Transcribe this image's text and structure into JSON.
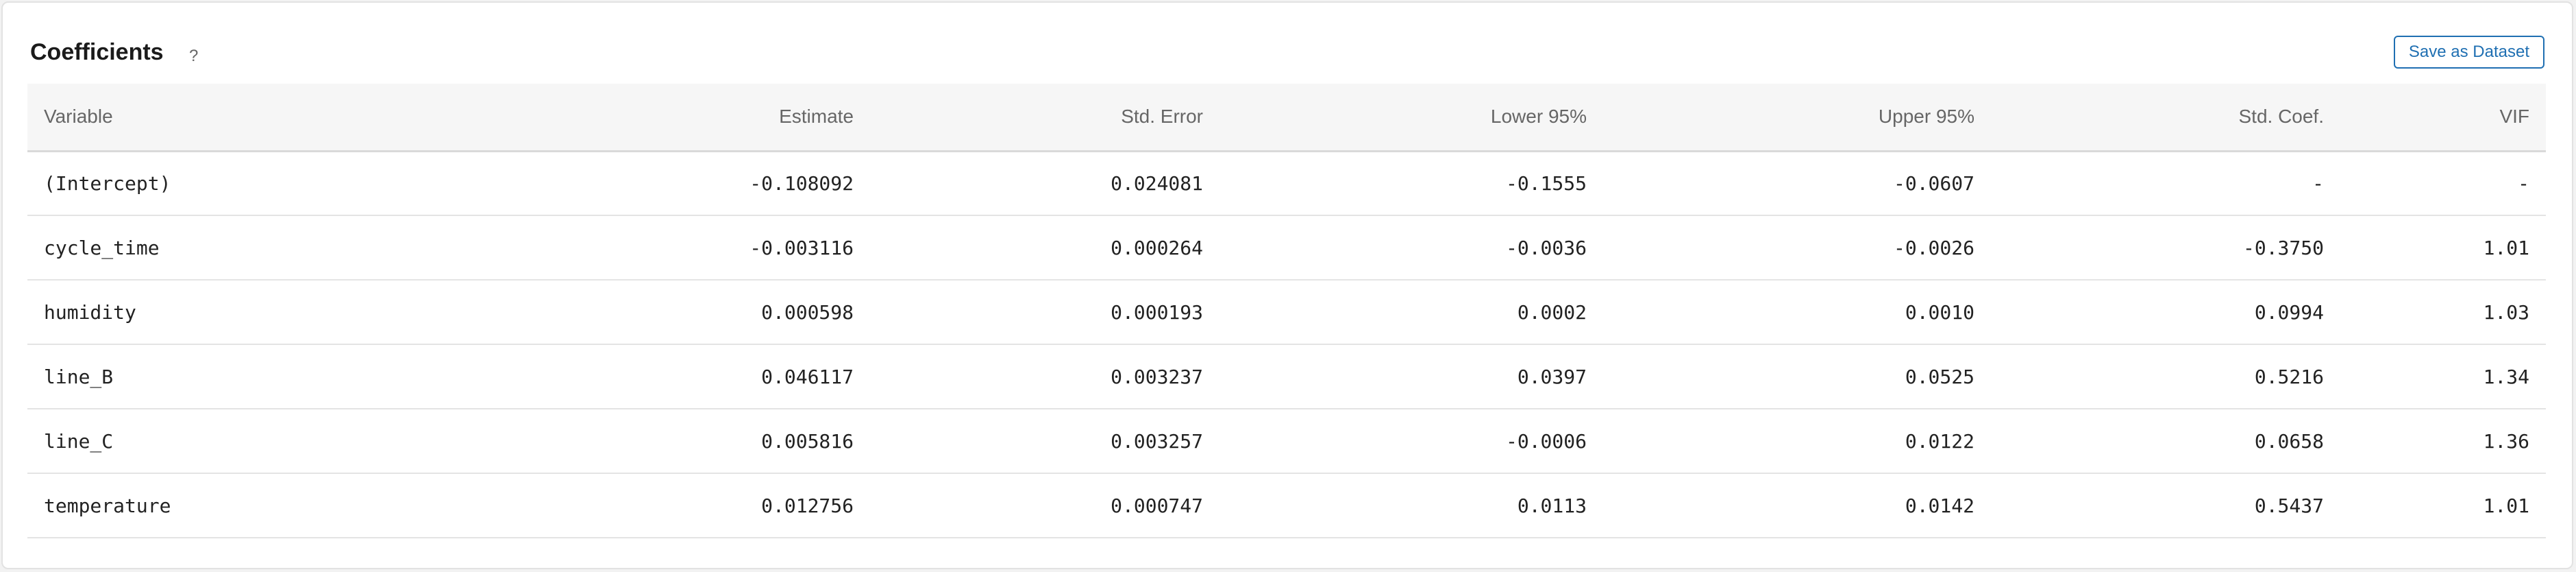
{
  "header": {
    "title": "Coefficients",
    "help_glyph": "?",
    "save_label": "Save as Dataset"
  },
  "table": {
    "columns": [
      "Variable",
      "Estimate",
      "Std. Error",
      "Lower 95%",
      "Upper 95%",
      "Std. Coef.",
      "VIF"
    ],
    "rows": [
      [
        "(Intercept)",
        "-0.108092",
        "0.024081",
        "-0.1555",
        "-0.0607",
        "-",
        "-"
      ],
      [
        "cycle_time",
        "-0.003116",
        "0.000264",
        "-0.0036",
        "-0.0026",
        "-0.3750",
        "1.01"
      ],
      [
        "humidity",
        "0.000598",
        "0.000193",
        "0.0002",
        "0.0010",
        "0.0994",
        "1.03"
      ],
      [
        "line_B",
        "0.046117",
        "0.003237",
        "0.0397",
        "0.0525",
        "0.5216",
        "1.34"
      ],
      [
        "line_C",
        "0.005816",
        "0.003257",
        "-0.0006",
        "0.0122",
        "0.0658",
        "1.36"
      ],
      [
        "temperature",
        "0.012756",
        "0.000747",
        "0.0113",
        "0.0142",
        "0.5437",
        "1.01"
      ]
    ]
  },
  "colors": {
    "accent": "#1f6fb2",
    "header_bg": "#f6f6f6",
    "border": "#e4e4e4"
  }
}
